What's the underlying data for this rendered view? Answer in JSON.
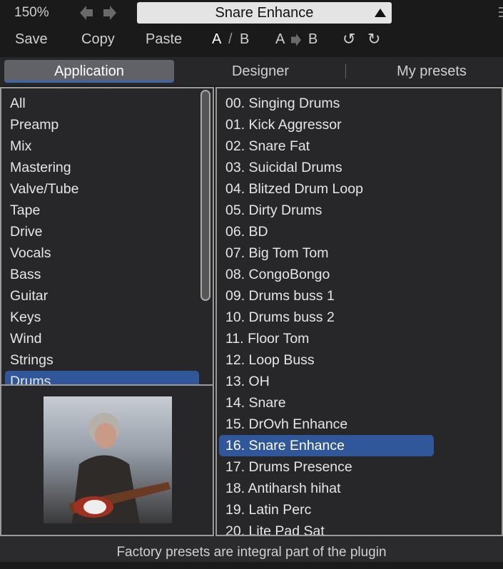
{
  "header": {
    "zoom": "150%",
    "preset_name": "Snare Enhance"
  },
  "toolbar": {
    "save": "Save",
    "copy": "Copy",
    "paste": "Paste",
    "a": "A",
    "slash": "/",
    "b": "B",
    "copy_a": "A",
    "copy_b": "B"
  },
  "tabs": [
    {
      "label": "Application"
    },
    {
      "label": "Designer"
    },
    {
      "label": "My presets"
    }
  ],
  "categories": [
    "All",
    "Preamp",
    "Mix",
    "Mastering",
    "Valve/Tube",
    "Tape",
    "Drive",
    "Vocals",
    "Bass",
    "Guitar",
    "Keys",
    "Wind",
    "Strings",
    "Drums"
  ],
  "selected_category": "Drums",
  "presets": [
    "00. Singing Drums",
    "01. Kick Aggressor",
    "02. Snare Fat",
    "03. Suicidal Drums",
    "04. Blitzed Drum Loop",
    "05. Dirty Drums",
    "06. BD",
    "07. Big Tom Tom",
    "08. CongoBongo",
    "09. Drums buss 1",
    "10. Drums buss 2",
    "11. Floor Tom",
    "12. Loop Buss",
    "13. OH",
    "14. Snare",
    "15. DrOvh Enhance",
    "16. Snare Enhance",
    "17. Drums Presence",
    "18. Antiharsh hihat",
    "19. Latin Perc",
    "20. Lite Pad Sat"
  ],
  "selected_preset": "16. Snare Enhance",
  "footer": "Factory presets are integral part of the plugin",
  "colors": {
    "accent": "#30579a",
    "background": "#1b1b1c"
  }
}
